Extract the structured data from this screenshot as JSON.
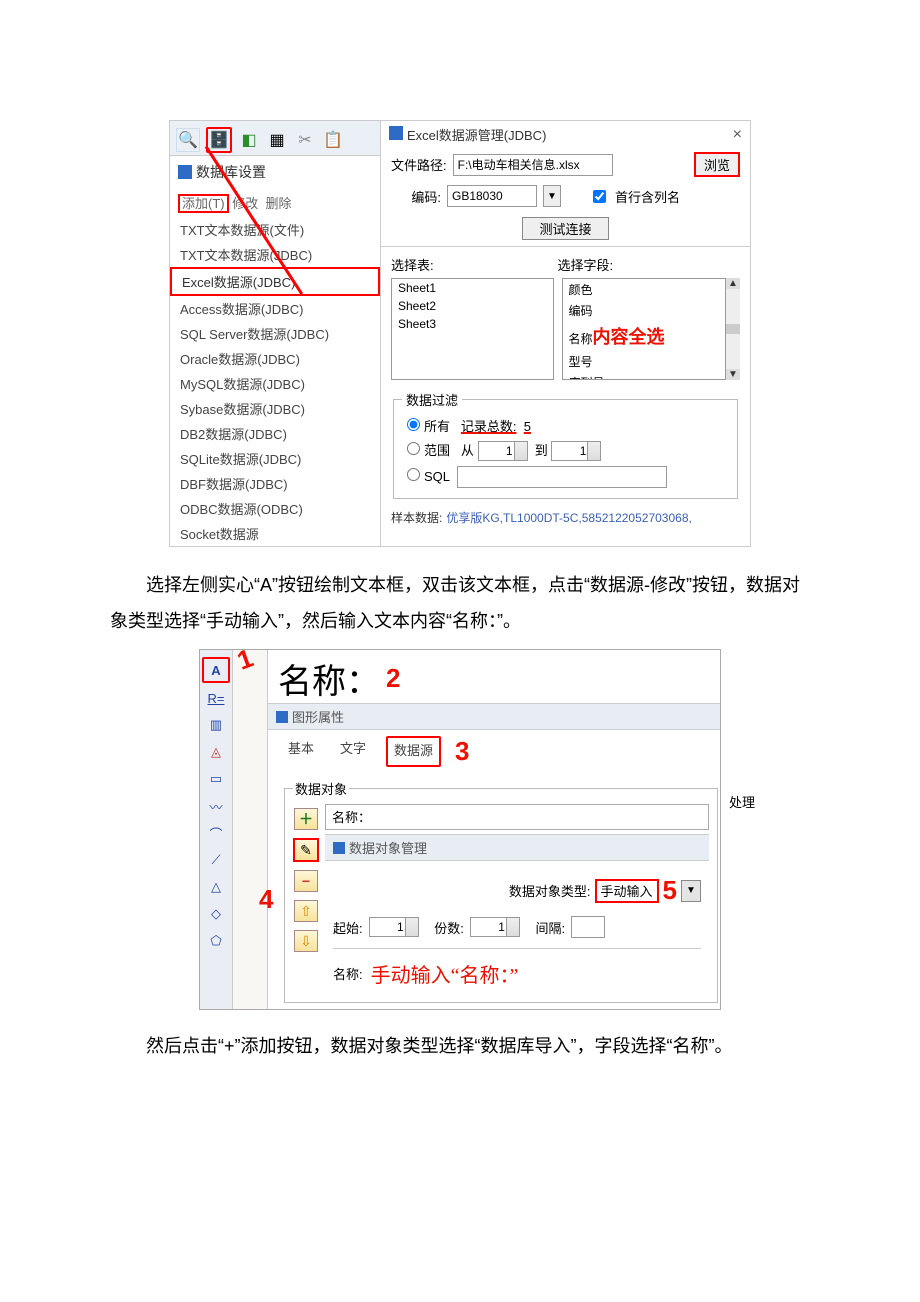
{
  "fig1": {
    "toolbar_icons": [
      "search",
      "db",
      "cube",
      "grid",
      "cut",
      "paste"
    ],
    "db_settings": "数据库设置",
    "actions": {
      "add": "添加(T)",
      "modify": "修改",
      "delete": "删除"
    },
    "sources": [
      "TXT文本数据源(文件)",
      "TXT文本数据源(JDBC)",
      "Excel数据源(JDBC)",
      "Access数据源(JDBC)",
      "SQL Server数据源(JDBC)",
      "Oracle数据源(JDBC)",
      "MySQL数据源(JDBC)",
      "Sybase数据源(JDBC)",
      "DB2数据源(JDBC)",
      "SQLite数据源(JDBC)",
      "DBF数据源(JDBC)",
      "ODBC数据源(ODBC)",
      "Socket数据源"
    ],
    "dialog_title": "Excel数据源管理(JDBC)",
    "path_label": "文件路径:",
    "path_value": "F:\\电动车相关信息.xlsx",
    "browse": "浏览",
    "encoding_label": "编码:",
    "encoding_value": "GB18030",
    "first_row_header": "首行含列名",
    "test_conn": "测试连接",
    "select_table": "选择表:",
    "select_field": "选择字段:",
    "tables": [
      "Sheet1",
      "Sheet2",
      "Sheet3"
    ],
    "fields": [
      "颜色",
      "编码",
      "名称",
      "型号",
      "序列号"
    ],
    "select_all_annot": "内容全选",
    "filter_group": "数据过滤",
    "radio_all": "所有",
    "record_count_label": "记录总数:",
    "record_count": "5",
    "radio_range": "范围",
    "from": "从",
    "to": "到",
    "range1": "1",
    "range2": "1",
    "radio_sql": "SQL",
    "sample_label": "样本数据:",
    "sample_value": "优享版KG,TL1000DT-5C,5852122052703068,"
  },
  "para1": "选择左侧实心“A”按钮绘制文本框，双击该文本框，点击“数据源-修改”按钮，数据对象类型选择“手动输入”，然后输入文本内容“名称：”。",
  "fig2": {
    "tool_icons": [
      "A",
      "R=",
      "bar",
      "warn",
      "rect",
      "curve",
      "arc",
      "shapeR",
      "tri",
      "diamond",
      "pent"
    ],
    "bigname": "名称：",
    "win_title": "图形属性",
    "tabs": [
      "基本",
      "文字",
      "数据源"
    ],
    "dataobj_group": "数据对象",
    "process": "处理",
    "name_label": "名称：",
    "dom_title": "数据对象管理",
    "dot_label": "数据对象类型:",
    "dot_value": "手动输入",
    "start": "起始:",
    "start_v": "1",
    "copies": "份数:",
    "copies_v": "1",
    "interval": "间隔:",
    "name2": "名称:",
    "hand_annot": "手动输入“名称：”",
    "n1": "1",
    "n2": "2",
    "n3": "3",
    "n4": "4",
    "n5": "5"
  },
  "para2": "然后点击“+”添加按钮，数据对象类型选择“数据库导入”，字段选择“名称”。"
}
